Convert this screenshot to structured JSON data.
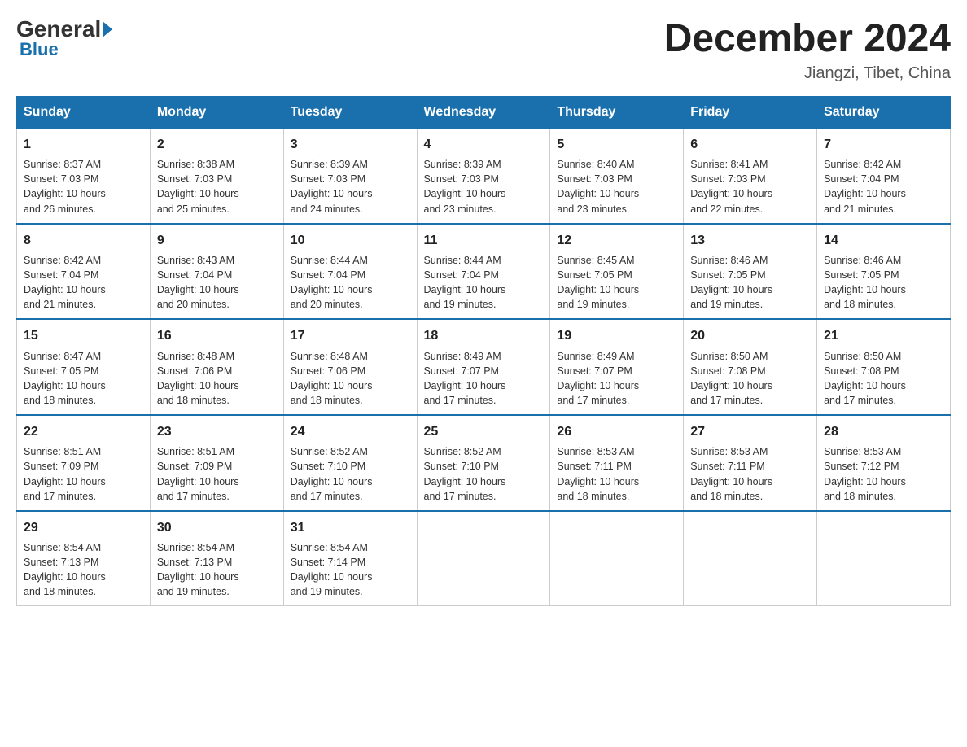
{
  "header": {
    "logo_general": "General",
    "logo_blue": "Blue",
    "month_title": "December 2024",
    "location": "Jiangzi, Tibet, China"
  },
  "days_of_week": [
    "Sunday",
    "Monday",
    "Tuesday",
    "Wednesday",
    "Thursday",
    "Friday",
    "Saturday"
  ],
  "weeks": [
    [
      {
        "day": "1",
        "sunrise": "8:37 AM",
        "sunset": "7:03 PM",
        "daylight": "10 hours and 26 minutes."
      },
      {
        "day": "2",
        "sunrise": "8:38 AM",
        "sunset": "7:03 PM",
        "daylight": "10 hours and 25 minutes."
      },
      {
        "day": "3",
        "sunrise": "8:39 AM",
        "sunset": "7:03 PM",
        "daylight": "10 hours and 24 minutes."
      },
      {
        "day": "4",
        "sunrise": "8:39 AM",
        "sunset": "7:03 PM",
        "daylight": "10 hours and 23 minutes."
      },
      {
        "day": "5",
        "sunrise": "8:40 AM",
        "sunset": "7:03 PM",
        "daylight": "10 hours and 23 minutes."
      },
      {
        "day": "6",
        "sunrise": "8:41 AM",
        "sunset": "7:03 PM",
        "daylight": "10 hours and 22 minutes."
      },
      {
        "day": "7",
        "sunrise": "8:42 AM",
        "sunset": "7:04 PM",
        "daylight": "10 hours and 21 minutes."
      }
    ],
    [
      {
        "day": "8",
        "sunrise": "8:42 AM",
        "sunset": "7:04 PM",
        "daylight": "10 hours and 21 minutes."
      },
      {
        "day": "9",
        "sunrise": "8:43 AM",
        "sunset": "7:04 PM",
        "daylight": "10 hours and 20 minutes."
      },
      {
        "day": "10",
        "sunrise": "8:44 AM",
        "sunset": "7:04 PM",
        "daylight": "10 hours and 20 minutes."
      },
      {
        "day": "11",
        "sunrise": "8:44 AM",
        "sunset": "7:04 PM",
        "daylight": "10 hours and 19 minutes."
      },
      {
        "day": "12",
        "sunrise": "8:45 AM",
        "sunset": "7:05 PM",
        "daylight": "10 hours and 19 minutes."
      },
      {
        "day": "13",
        "sunrise": "8:46 AM",
        "sunset": "7:05 PM",
        "daylight": "10 hours and 19 minutes."
      },
      {
        "day": "14",
        "sunrise": "8:46 AM",
        "sunset": "7:05 PM",
        "daylight": "10 hours and 18 minutes."
      }
    ],
    [
      {
        "day": "15",
        "sunrise": "8:47 AM",
        "sunset": "7:05 PM",
        "daylight": "10 hours and 18 minutes."
      },
      {
        "day": "16",
        "sunrise": "8:48 AM",
        "sunset": "7:06 PM",
        "daylight": "10 hours and 18 minutes."
      },
      {
        "day": "17",
        "sunrise": "8:48 AM",
        "sunset": "7:06 PM",
        "daylight": "10 hours and 18 minutes."
      },
      {
        "day": "18",
        "sunrise": "8:49 AM",
        "sunset": "7:07 PM",
        "daylight": "10 hours and 17 minutes."
      },
      {
        "day": "19",
        "sunrise": "8:49 AM",
        "sunset": "7:07 PM",
        "daylight": "10 hours and 17 minutes."
      },
      {
        "day": "20",
        "sunrise": "8:50 AM",
        "sunset": "7:08 PM",
        "daylight": "10 hours and 17 minutes."
      },
      {
        "day": "21",
        "sunrise": "8:50 AM",
        "sunset": "7:08 PM",
        "daylight": "10 hours and 17 minutes."
      }
    ],
    [
      {
        "day": "22",
        "sunrise": "8:51 AM",
        "sunset": "7:09 PM",
        "daylight": "10 hours and 17 minutes."
      },
      {
        "day": "23",
        "sunrise": "8:51 AM",
        "sunset": "7:09 PM",
        "daylight": "10 hours and 17 minutes."
      },
      {
        "day": "24",
        "sunrise": "8:52 AM",
        "sunset": "7:10 PM",
        "daylight": "10 hours and 17 minutes."
      },
      {
        "day": "25",
        "sunrise": "8:52 AM",
        "sunset": "7:10 PM",
        "daylight": "10 hours and 17 minutes."
      },
      {
        "day": "26",
        "sunrise": "8:53 AM",
        "sunset": "7:11 PM",
        "daylight": "10 hours and 18 minutes."
      },
      {
        "day": "27",
        "sunrise": "8:53 AM",
        "sunset": "7:11 PM",
        "daylight": "10 hours and 18 minutes."
      },
      {
        "day": "28",
        "sunrise": "8:53 AM",
        "sunset": "7:12 PM",
        "daylight": "10 hours and 18 minutes."
      }
    ],
    [
      {
        "day": "29",
        "sunrise": "8:54 AM",
        "sunset": "7:13 PM",
        "daylight": "10 hours and 18 minutes."
      },
      {
        "day": "30",
        "sunrise": "8:54 AM",
        "sunset": "7:13 PM",
        "daylight": "10 hours and 19 minutes."
      },
      {
        "day": "31",
        "sunrise": "8:54 AM",
        "sunset": "7:14 PM",
        "daylight": "10 hours and 19 minutes."
      },
      null,
      null,
      null,
      null
    ]
  ],
  "labels": {
    "sunrise": "Sunrise:",
    "sunset": "Sunset:",
    "daylight": "Daylight:"
  }
}
